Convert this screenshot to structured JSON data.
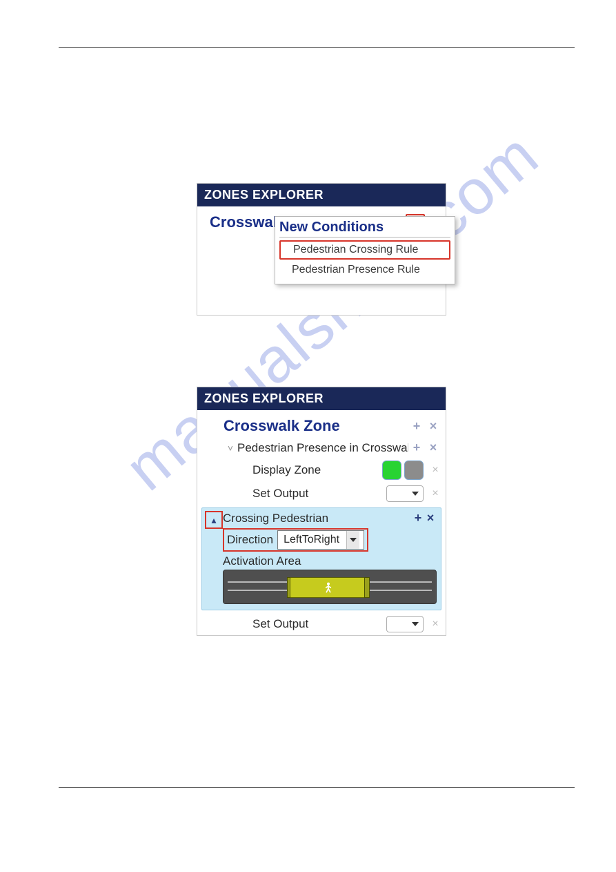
{
  "watermark": "manualshive.com",
  "panel1": {
    "header": "ZONES EXPLORER",
    "zone_title": "Crosswalk Zone",
    "popup": {
      "title": "New Conditions",
      "items": [
        "Pedestrian Crossing Rule",
        "Pedestrian Presence Rule"
      ]
    }
  },
  "panel2": {
    "header": "ZONES EXPLORER",
    "zone_title": "Crosswalk Zone",
    "rule_presence_label": "Pedestrian Presence in Crosswalk Z",
    "display_zone_label": "Display Zone",
    "set_output_label": "Set Output",
    "crossing": {
      "title": "Crossing Pedestrian",
      "direction_label": "Direction",
      "direction_value": "LeftToRight",
      "activation_label": "Activation Area"
    }
  }
}
